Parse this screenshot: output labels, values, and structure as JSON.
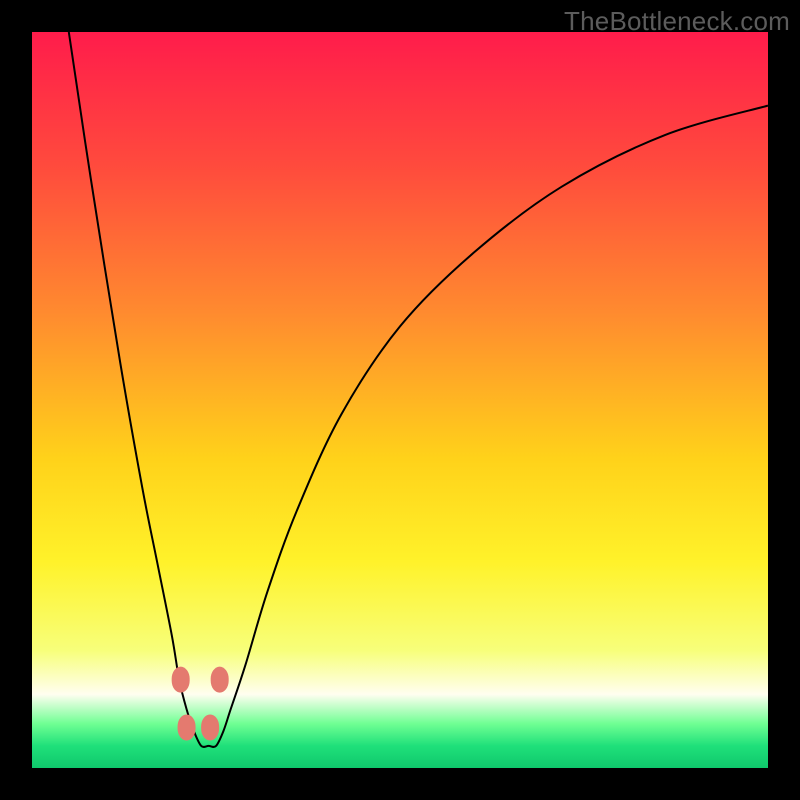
{
  "watermark": "TheBottleneck.com",
  "chart_data": {
    "type": "line",
    "title": "",
    "xlabel": "",
    "ylabel": "",
    "xlim": [
      0,
      100
    ],
    "ylim": [
      0,
      100
    ],
    "grid": false,
    "legend": false,
    "gradient_stops": [
      {
        "offset": 0.0,
        "color": "#ff1c4b"
      },
      {
        "offset": 0.18,
        "color": "#ff4a3d"
      },
      {
        "offset": 0.38,
        "color": "#ff8a2f"
      },
      {
        "offset": 0.58,
        "color": "#ffd21a"
      },
      {
        "offset": 0.72,
        "color": "#fff22a"
      },
      {
        "offset": 0.84,
        "color": "#f7ff7a"
      },
      {
        "offset": 0.9,
        "color": "#fffef0"
      },
      {
        "offset": 0.94,
        "color": "#6fff93"
      },
      {
        "offset": 0.97,
        "color": "#1fe07a"
      },
      {
        "offset": 1.0,
        "color": "#0fc86c"
      }
    ],
    "series": [
      {
        "name": "curve",
        "x": [
          5.0,
          8.0,
          12.0,
          15.0,
          17.0,
          19.0,
          20.0,
          21.0,
          22.0,
          23.0,
          24.0,
          25.0,
          26.0,
          27.0,
          29.0,
          32.0,
          36.0,
          42.0,
          50.0,
          60.0,
          72.0,
          86.0,
          100.0
        ],
        "values": [
          100.0,
          80.0,
          55.0,
          38.0,
          28.0,
          18.0,
          12.0,
          8.0,
          5.0,
          3.0,
          3.0,
          3.0,
          5.0,
          8.0,
          14.0,
          24.0,
          35.0,
          48.0,
          60.0,
          70.0,
          79.0,
          86.0,
          90.0
        ]
      }
    ],
    "markers": [
      {
        "x": 20.2,
        "y": 12.0
      },
      {
        "x": 21.0,
        "y": 5.5
      },
      {
        "x": 24.2,
        "y": 5.5
      },
      {
        "x": 25.5,
        "y": 12.0
      }
    ],
    "marker_color": "#e47a6f",
    "curve_color": "#000000"
  }
}
